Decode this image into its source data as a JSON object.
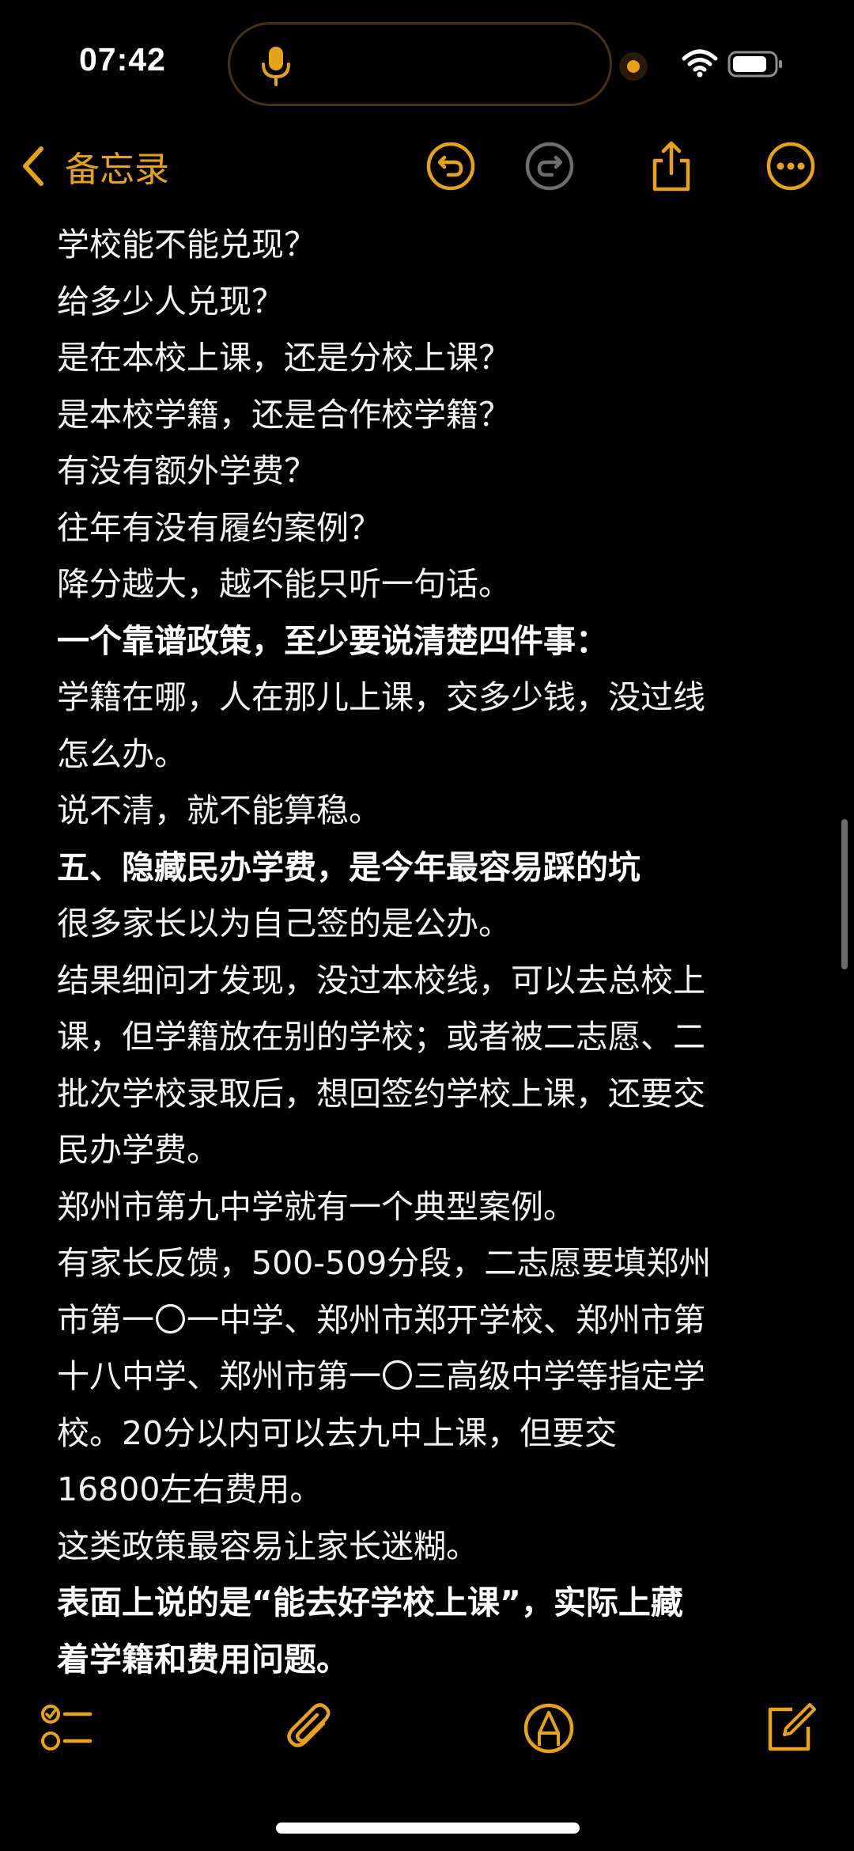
{
  "status_bar": {
    "time": "07:42"
  },
  "colors": {
    "accent": "#e8a21a",
    "background": "#000000",
    "text": "#f2f2f2",
    "disabled_icon": "#6e6e6e"
  },
  "nav": {
    "back_label": "备忘录",
    "icons": [
      "undo-icon",
      "redo-icon",
      "share-icon",
      "more-icon"
    ]
  },
  "note": {
    "lines": [
      {
        "text": "学校能不能兑现？",
        "bold": false
      },
      {
        "text": "给多少人兑现？",
        "bold": false
      },
      {
        "text": "是在本校上课，还是分校上课？",
        "bold": false
      },
      {
        "text": "是本校学籍，还是合作校学籍？",
        "bold": false
      },
      {
        "text": "有没有额外学费？",
        "bold": false
      },
      {
        "text": "往年有没有履约案例？",
        "bold": false
      },
      {
        "text": "降分越大，越不能只听一句话。",
        "bold": false
      },
      {
        "text": "一个靠谱政策，至少要说清楚四件事：",
        "bold": true
      },
      {
        "text": "学籍在哪，人在那儿上课，交多少钱，没过线",
        "bold": false
      },
      {
        "text": "怎么办。",
        "bold": false
      },
      {
        "text": "说不清，就不能算稳。",
        "bold": false
      },
      {
        "text": "五、隐藏民办学费，是今年最容易踩的坑",
        "bold": true
      },
      {
        "text": "很多家长以为自己签的是公办。",
        "bold": false
      },
      {
        "text": "结果细问才发现，没过本校线，可以去总校上",
        "bold": false
      },
      {
        "text": "课，但学籍放在别的学校；或者被二志愿、二",
        "bold": false
      },
      {
        "text": "批次学校录取后，想回签约学校上课，还要交",
        "bold": false
      },
      {
        "text": "民办学费。",
        "bold": false
      },
      {
        "text": "郑州市第九中学就有一个典型案例。",
        "bold": false
      },
      {
        "text": "有家长反馈，500-509分段，二志愿要填郑州",
        "bold": false
      },
      {
        "text": "市第一〇一中学、郑州市郑开学校、郑州市第",
        "bold": false
      },
      {
        "text": "十八中学、郑州市第一〇三高级中学等指定学",
        "bold": false
      },
      {
        "text": "校。20分以内可以去九中上课，但要交",
        "bold": false
      },
      {
        "text": "16800左右费用。",
        "bold": false
      },
      {
        "text": "这类政策最容易让家长迷糊。",
        "bold": false
      },
      {
        "text": "表面上说的是“能去好学校上课”，实际上藏",
        "bold": true
      },
      {
        "text": "着学籍和费用问题。",
        "bold": true
      }
    ]
  },
  "toolbar": {
    "icons": [
      "checklist-icon",
      "attachment-icon",
      "markup-icon",
      "compose-icon"
    ]
  }
}
